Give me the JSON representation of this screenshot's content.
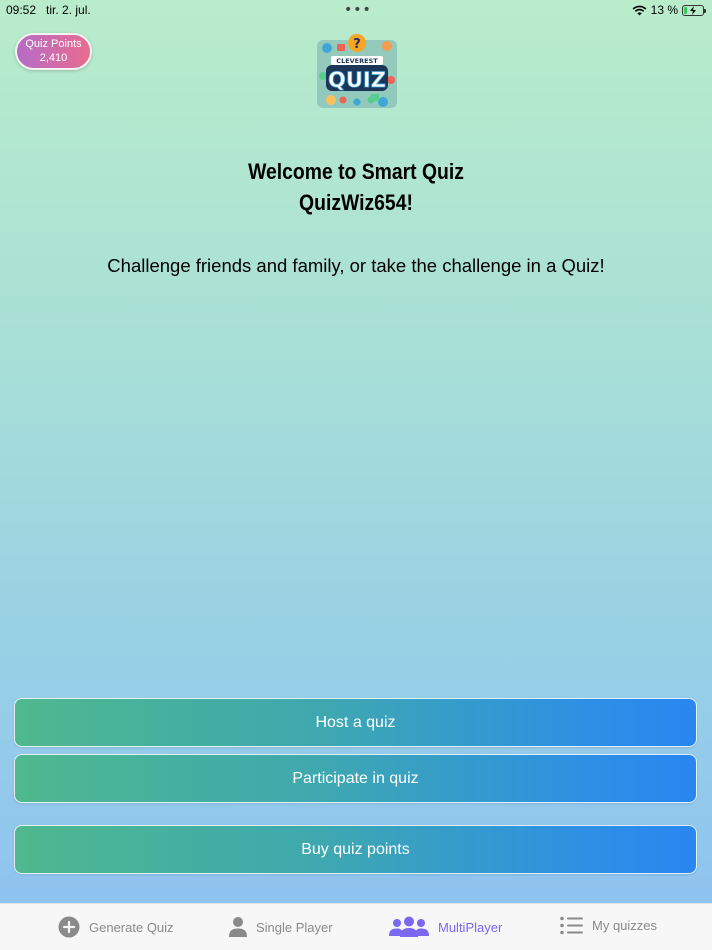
{
  "status_bar": {
    "time": "09:52",
    "date": "tir. 2. jul.",
    "battery_text": "13 %",
    "battery_level": 0.13
  },
  "points": {
    "label": "Quiz Points",
    "value": "2,410"
  },
  "logo": {
    "top_text": "CLEVEREST",
    "main_text": "QUIZ",
    "icon": "quiz-logo-icon"
  },
  "welcome": {
    "line1": "Welcome to Smart Quiz",
    "line2": "QuizWiz654!"
  },
  "subtitle": "Challenge friends and family, or take the challenge in a Quiz!",
  "buttons": {
    "host": "Host a quiz",
    "participate": "Participate in quiz",
    "buy": "Buy quiz points"
  },
  "tabs": [
    {
      "label": "Generate Quiz",
      "icon": "plus-circle-icon",
      "active": false
    },
    {
      "label": "Single Player",
      "icon": "person-icon",
      "active": false
    },
    {
      "label": "MultiPlayer",
      "icon": "people-icon",
      "active": true
    },
    {
      "label": "My quizzes",
      "icon": "list-icon",
      "active": false
    }
  ],
  "colors": {
    "accent": "#7a68f0",
    "tab_inactive": "#8a8a8a",
    "badge_start": "#b56cc7",
    "badge_end": "#e96c8f",
    "button_start": "#4fb88e",
    "button_end": "#2a86f0"
  }
}
